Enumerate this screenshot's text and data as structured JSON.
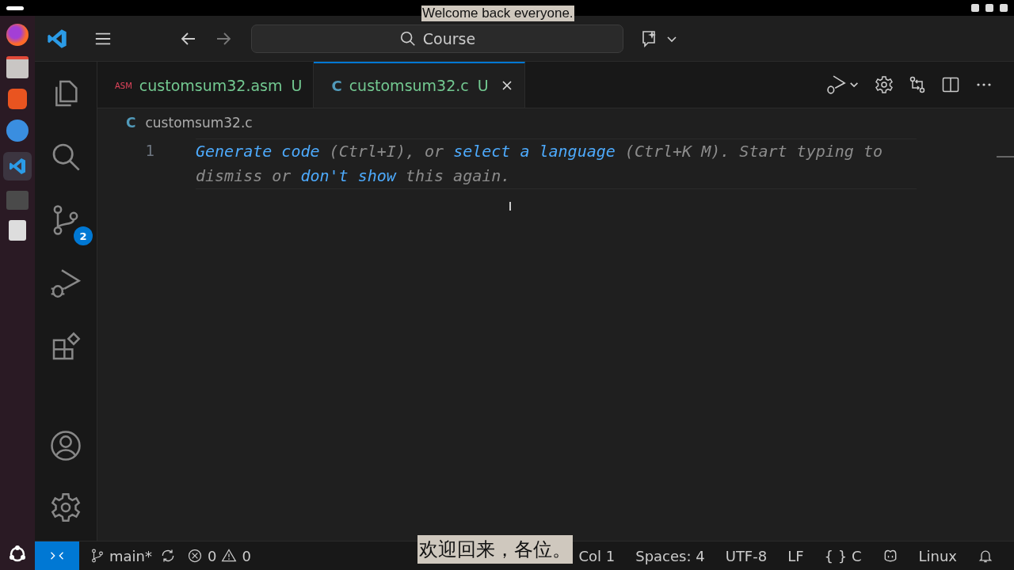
{
  "search": {
    "text": "Course"
  },
  "tabs": [
    {
      "icon": "ASM",
      "label": "customsum32.asm",
      "badge": "U",
      "selected": false
    },
    {
      "icon": "C",
      "label": "customsum32.c",
      "badge": "U",
      "selected": true
    }
  ],
  "activity_bar": {
    "scm_badge": "2"
  },
  "breadcrumb": {
    "icon": "C",
    "label": "customsum32.c"
  },
  "editor": {
    "line_number": "1",
    "hint": [
      {
        "kind": "link",
        "text": "Generate code"
      },
      {
        "kind": "plain",
        "text": " (Ctrl+I), or "
      },
      {
        "kind": "link",
        "text": "select a language"
      },
      {
        "kind": "plain",
        "text": " (Ctrl+K M). Start typing to dismiss or "
      },
      {
        "kind": "link",
        "text": "don't show"
      },
      {
        "kind": "plain",
        "text": " this again."
      }
    ]
  },
  "status_bar": {
    "branch": "main*",
    "errors": "0",
    "warnings": "0",
    "right": [
      {
        "kind": "text",
        "text": "Col 1"
      },
      {
        "kind": "text",
        "text": "Spaces: 4"
      },
      {
        "kind": "text",
        "text": "UTF-8"
      },
      {
        "kind": "text",
        "text": "LF"
      },
      {
        "kind": "text",
        "text": "{ } C"
      },
      {
        "kind": "copilot"
      },
      {
        "kind": "text",
        "text": "Linux"
      },
      {
        "kind": "bell"
      }
    ]
  },
  "captions": [
    "Welcome back everyone.",
    "欢迎回来，各位。"
  ]
}
